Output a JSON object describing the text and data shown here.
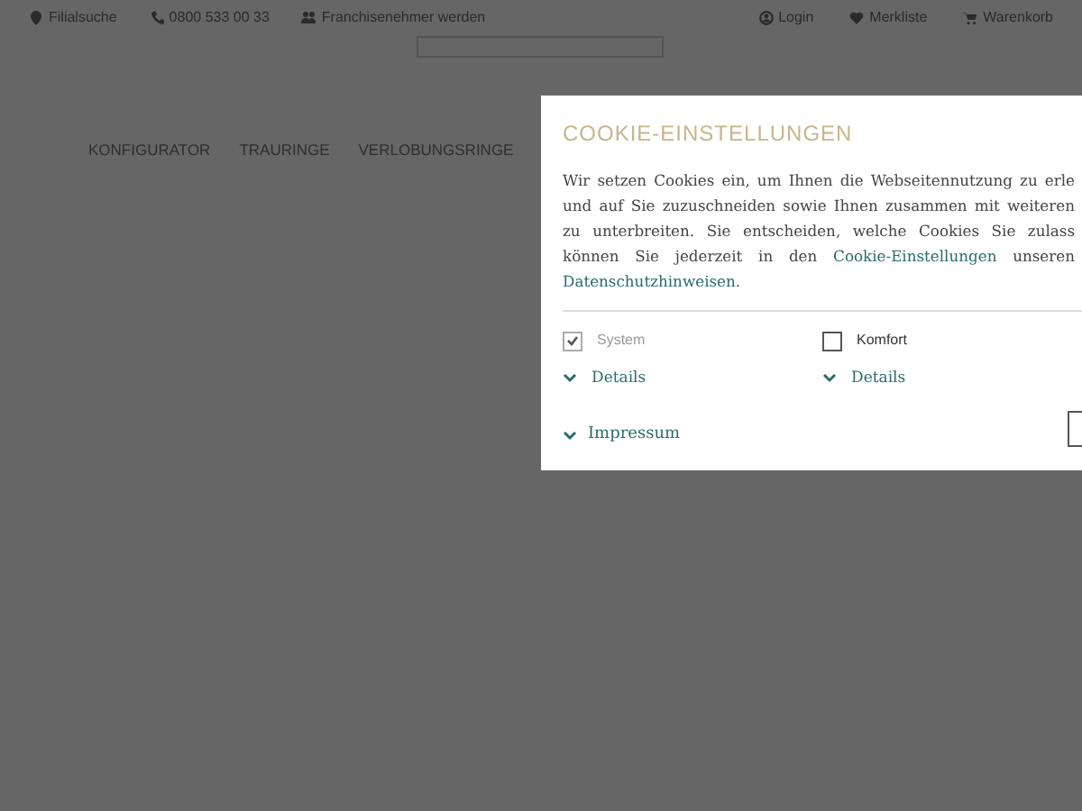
{
  "top_bar": {
    "left_links": [
      {
        "kind": "pin",
        "label": "Filialsuche"
      },
      {
        "kind": "phone",
        "label": "0800 533 00 33"
      },
      {
        "kind": "users",
        "label": "Franchisenehmer werden"
      }
    ],
    "right_links": [
      {
        "kind": "user",
        "label": "Login"
      },
      {
        "kind": "heart",
        "label": "Merkliste"
      },
      {
        "kind": "cart",
        "label": "Warenkorb"
      }
    ]
  },
  "nav": [
    "KONFIGURATOR",
    "TRAURINGE",
    "VERLOBUNGSRINGE"
  ],
  "cookie_dialog": {
    "title": "COOKIE-EINSTELLUNGEN",
    "text": [
      {
        "text": "Wir setzen Cookies ein, um Ihnen die Webseitennutzung zu erle und auf Sie zuzuschneiden sowie Ihnen zusammen mit weiteren zu unterbreiten. Sie entscheiden, welche Cookies Sie zulass können Sie jederzeit in den ",
        "link": false
      },
      {
        "text": "Cookie-Einstellungen",
        "link": true
      },
      {
        "text": " unseren ",
        "link": false
      },
      {
        "text": "Datenschutzhinweisen",
        "link": true
      },
      {
        "text": ".",
        "link": false
      }
    ],
    "options": [
      {
        "label": "System",
        "checked": true,
        "disabled": true,
        "details": "Details"
      },
      {
        "label": "Komfort",
        "checked": false,
        "disabled": false,
        "details": "Details"
      }
    ],
    "footer_link": "Impressum"
  }
}
